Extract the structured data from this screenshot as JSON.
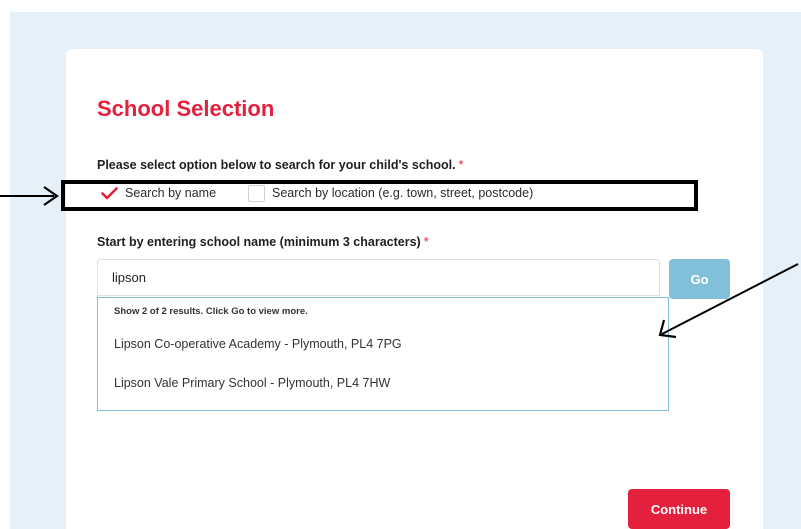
{
  "page": {
    "title": "School Selection",
    "required_marker": "*"
  },
  "search_mode": {
    "prompt": "Please select option below to search for your child's school.",
    "options": [
      {
        "label": "Search by name",
        "checked": true
      },
      {
        "label": "Search by location (e.g. town, street, postcode)",
        "checked": false
      }
    ]
  },
  "school_name": {
    "label": "Start by entering school name (minimum 3 characters)",
    "value": "lipson",
    "go_label": "Go"
  },
  "results": {
    "hint": "Show 2 of 2 results. Click Go to view more.",
    "items": [
      "Lipson Co-operative Academy - Plymouth, PL4 7PG",
      "Lipson Vale Primary School - Plymouth, PL4 7HW"
    ]
  },
  "actions": {
    "continue_label": "Continue"
  },
  "colors": {
    "accent_red": "#e4213d",
    "go_button": "#82c0da",
    "results_border": "#7fc1d9",
    "background": "#e6f0f9"
  }
}
